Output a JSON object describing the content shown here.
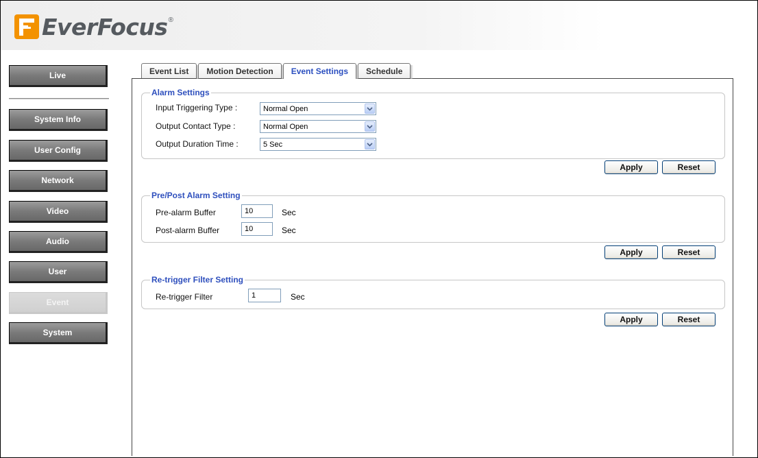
{
  "brand": {
    "name": "EverFocus",
    "registered": "®"
  },
  "sidebar": {
    "items": [
      {
        "label": "Live",
        "active": false
      },
      {
        "label": "System Info",
        "active": false
      },
      {
        "label": "User Config",
        "active": false
      },
      {
        "label": "Network",
        "active": false
      },
      {
        "label": "Video",
        "active": false
      },
      {
        "label": "Audio",
        "active": false
      },
      {
        "label": "User",
        "active": false
      },
      {
        "label": "Event",
        "active": true
      },
      {
        "label": "System",
        "active": false
      }
    ]
  },
  "tabs": [
    {
      "label": "Event List",
      "active": false
    },
    {
      "label": "Motion Detection",
      "active": false
    },
    {
      "label": "Event Settings",
      "active": true
    },
    {
      "label": "Schedule",
      "active": false
    }
  ],
  "alarm": {
    "title": "Alarm Settings",
    "input_type_label": "Input Triggering Type :",
    "input_type_value": "Normal Open",
    "output_contact_label": "Output Contact Type :",
    "output_contact_value": "Normal Open",
    "output_duration_label": "Output Duration Time :",
    "output_duration_value": "5 Sec"
  },
  "prepost": {
    "title": "Pre/Post Alarm Setting",
    "pre_label": "Pre-alarm Buffer",
    "pre_value": "10",
    "post_label": "Post-alarm Buffer",
    "post_value": "10",
    "unit": "Sec"
  },
  "retrigger": {
    "title": "Re-trigger Filter Setting",
    "label": "Re-trigger Filter",
    "value": "1",
    "unit": "Sec"
  },
  "buttons": {
    "apply": "Apply",
    "reset": "Reset"
  },
  "colors": {
    "accent": "#2e4fbd",
    "sidebar_button": "#7a7a7a",
    "logo_orange": "#f39200"
  }
}
